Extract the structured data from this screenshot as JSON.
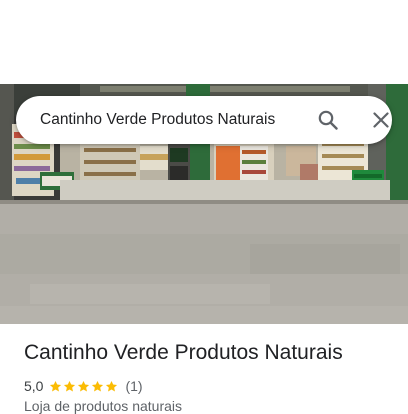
{
  "search": {
    "query": "Cantinho Verde Produtos Naturais"
  },
  "icons": {
    "search": "search-icon",
    "close": "close-icon",
    "star": "star-icon"
  },
  "place": {
    "name": "Cantinho Verde Produtos Naturais",
    "rating": "5,0",
    "stars": 5,
    "review_count": "(1)",
    "category": "Loja de produtos naturais"
  },
  "colors": {
    "star": "#fbbc04",
    "storefront_green": "#2e6b3a"
  }
}
